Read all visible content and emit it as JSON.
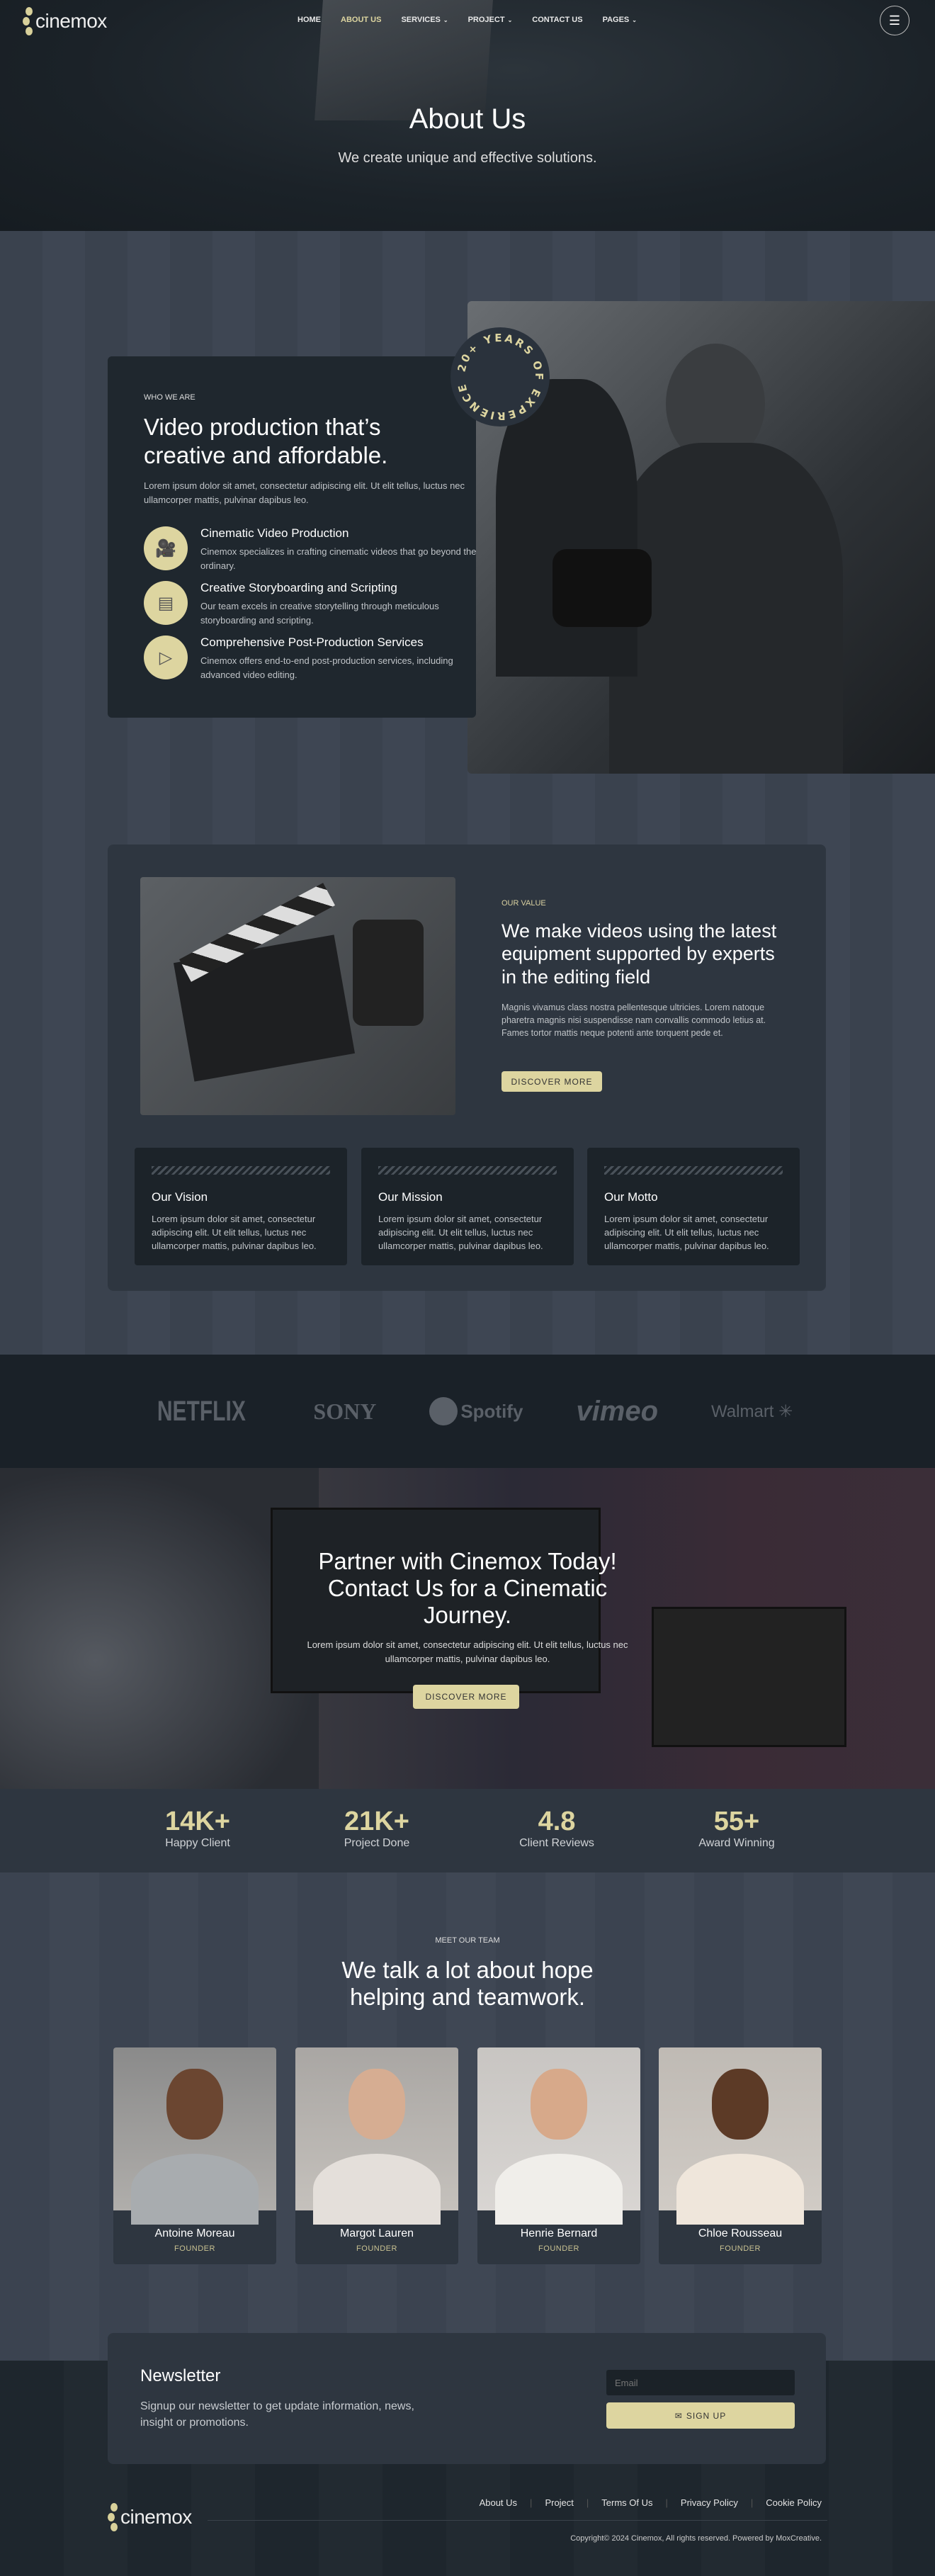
{
  "brand": {
    "name": "cinemox",
    "accent": "#ddd5a0"
  },
  "nav": {
    "items": [
      {
        "label": "HOME"
      },
      {
        "label": "ABOUT US"
      },
      {
        "label": "SERVICES",
        "dropdown": true
      },
      {
        "label": "PROJECT",
        "dropdown": true
      },
      {
        "label": "CONTACT US"
      },
      {
        "label": "PAGES",
        "dropdown": true
      }
    ],
    "menu_icon": "hamburger-icon"
  },
  "hero": {
    "title": "About Us",
    "subtitle": "We create unique and effective solutions."
  },
  "who": {
    "eyebrow": "WHO WE ARE",
    "title_line1": "Video production that’s",
    "title_line2": "creative and affordable.",
    "text": "Lorem ipsum dolor sit amet, consectetur adipiscing elit. Ut elit tellus, luctus nec ullamcorper mattis, pulvinar dapibus leo.",
    "badge": "20+ YEARS OF EXPERIENCE",
    "services": [
      {
        "icon": "video-camera-icon",
        "title": "Cinematic Video Production",
        "text": "Cinemox specializes in crafting cinematic videos that go beyond the ordinary."
      },
      {
        "icon": "document-icon",
        "title": "Creative Storyboarding and Scripting",
        "text": "Our team excels in creative storytelling through meticulous storyboarding and scripting."
      },
      {
        "icon": "film-play-icon",
        "title": "Comprehensive Post-Production Services",
        "text": "Cinemox offers end-to-end post-production services, including advanced video editing."
      }
    ]
  },
  "value": {
    "eyebrow": "OUR VALUE",
    "title": "We make videos using the latest equipment supported by experts in the editing field",
    "text": "Magnis vivamus class nostra pellentesque ultricies. Lorem natoque pharetra magnis nisi suspendisse nam convallis commodo letius at. Fames tortor mattis neque potenti ante torquent pede et.",
    "button": "DISCOVER MORE",
    "cards": [
      {
        "title": "Our Vision",
        "text": "Lorem ipsum dolor sit amet, consectetur adipiscing elit. Ut elit tellus, luctus nec ullamcorper mattis, pulvinar dapibus leo."
      },
      {
        "title": "Our Mission",
        "text": "Lorem ipsum dolor sit amet, consectetur adipiscing elit. Ut elit tellus, luctus nec ullamcorper mattis, pulvinar dapibus leo."
      },
      {
        "title": "Our Motto",
        "text": "Lorem ipsum dolor sit amet, consectetur adipiscing elit. Ut elit tellus, luctus nec ullamcorper mattis, pulvinar dapibus leo."
      }
    ]
  },
  "logos": [
    "NETFLIX",
    "SONY",
    "Spotify",
    "vimeo",
    "Walmart"
  ],
  "cta": {
    "title": "Partner with Cinemox Today! Contact Us for a Cinematic Journey.",
    "text": "Lorem ipsum dolor sit amet, consectetur adipiscing elit. Ut elit tellus, luctus nec ullamcorper mattis, pulvinar dapibus leo.",
    "button": "DISCOVER MORE"
  },
  "stats": [
    {
      "value": "14K+",
      "label": "Happy Client"
    },
    {
      "value": "21K+",
      "label": "Project Done"
    },
    {
      "value": "4.8",
      "label": "Client Reviews"
    },
    {
      "value": "55+",
      "label": "Award Winning"
    }
  ],
  "team": {
    "eyebrow": "MEET OUR TEAM",
    "title_line1": "We talk a lot about hope",
    "title_line2": "helping and teamwork.",
    "members": [
      {
        "name": "Antoine Moreau",
        "role": "FOUNDER"
      },
      {
        "name": "Margot Lauren",
        "role": "FOUNDER"
      },
      {
        "name": "Henrie Bernard",
        "role": "FOUNDER"
      },
      {
        "name": "Chloe Rousseau",
        "role": "FOUNDER"
      }
    ]
  },
  "newsletter": {
    "title": "Newsletter",
    "text": "Signup our newsletter to get update information, news, insight or promotions.",
    "email_placeholder": "Email",
    "button": "SIGN UP"
  },
  "footer": {
    "links": [
      "About Us",
      "Project",
      "Terms Of Us",
      "Privacy Policy",
      "Cookie Policy"
    ],
    "copyright": "Copyright© 2024 Cinemox, All rights reserved. Powered by MoxCreative."
  }
}
